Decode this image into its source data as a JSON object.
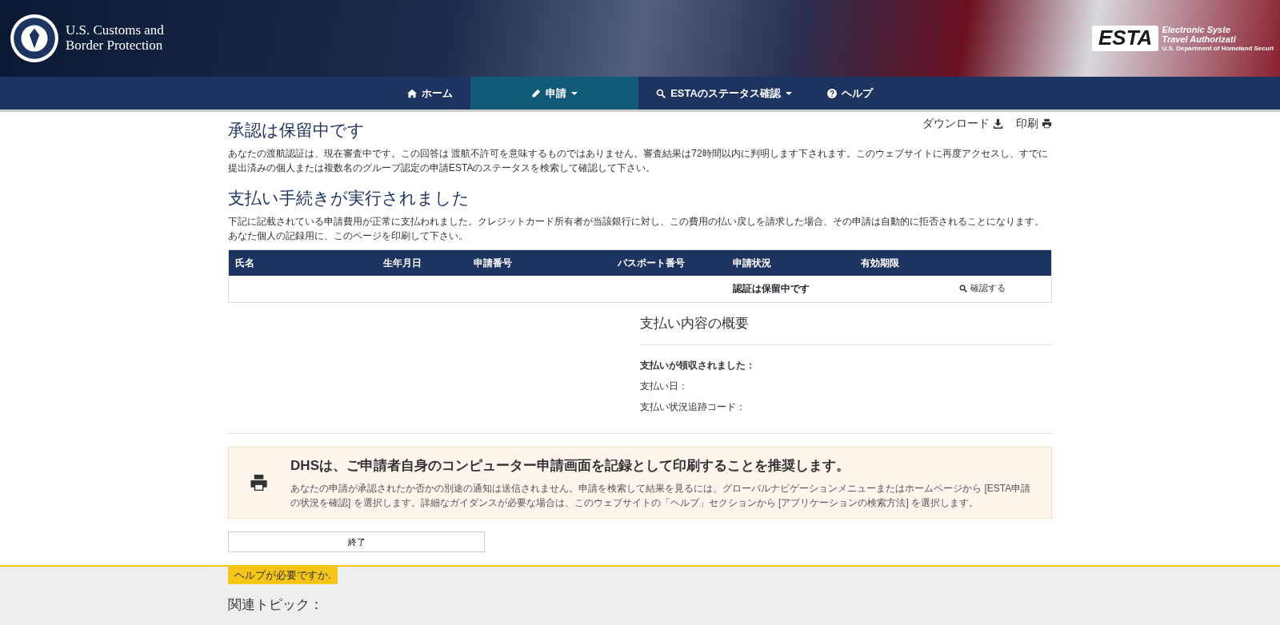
{
  "header": {
    "agency_name": "U.S. Customs and Border Protection",
    "esta_logo": {
      "mark": "ESTA",
      "line_1": "Electronic Syste",
      "line_2": "Travel Authorizati",
      "line_3": "U.S. Department of Homeland Securi"
    }
  },
  "nav": [
    {
      "label": "ホーム",
      "dropdown": false,
      "selected": false
    },
    {
      "label": "申請",
      "dropdown": true,
      "selected": true
    },
    {
      "label": "ESTAのステータス確認",
      "dropdown": true,
      "selected": false
    },
    {
      "label": "ヘルプ",
      "dropdown": false,
      "selected": false
    }
  ],
  "actions": [
    "ダウンロード",
    "印刷"
  ],
  "pending": {
    "title": "承認は保留中です",
    "text": "あなたの渡航認証は、現在審査中です。この回答は 渡航不許可を意味するものではありません。審査結果は72時間以内に判明します下されます。このウェブサイトに再度アクセスし、すでに提出済みの個人または複数名のグループ認定の申請ESTAのステータスを検索して確認して下さい。"
  },
  "payment": {
    "title": "支払い手続きが実行されました",
    "text": "下記に記載されている申請費用が正常に支払われました。クレジットカード所有者が当該銀行に対し、この費用の払い戻しを請求した場合、その申請は自動的に拒否されることになります。あなた個人の記録用に、このページを印刷して下さい。"
  },
  "table": {
    "columns": [
      "氏名",
      "生年月日",
      "申請番号",
      "パスポート番号",
      "申請状況",
      "有効期限"
    ],
    "rows": [
      {
        "status": "認証は保留中です",
        "action": "確認する"
      }
    ]
  },
  "summary": {
    "title": "支払い内容の概要",
    "received_label": "支払いが領収されました：",
    "date_label": "支払い日：",
    "tracking_label": "支払い状況追跡コード："
  },
  "notice": {
    "title": "DHSは、ご申請者自身のコンピューター申請画面を記録として印刷することを推奨します。",
    "text": "あなたの申請が承認されたか否かの別途の通知は送信されません。申請を検索して結果を見るには、グローバルナビゲーションメニューまたはホームページから [ESTA申請の状況を確認] を選択します。詳細なガイダンスが必要な場合は、このウェブサイトの「ヘルプ」セクションから [アプリケーションの検索方法] を選択します。"
  },
  "close_button": "終了",
  "footer": {
    "help_tag": "ヘルプが必要ですか.",
    "topics_title": "関連トピック："
  }
}
